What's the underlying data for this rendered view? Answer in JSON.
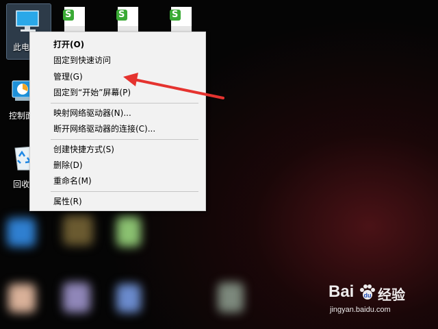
{
  "desktop": {
    "icons": [
      {
        "label": "此电",
        "icon": "computer-icon"
      },
      {
        "label": "控制面",
        "icon": "control-panel-icon"
      },
      {
        "label": "回收",
        "icon": "recycle-bin-icon"
      }
    ],
    "file_icon_badge": "S"
  },
  "context_menu": {
    "items": [
      {
        "label": "打开(O)"
      },
      {
        "label": "固定到快速访问"
      },
      {
        "label": "管理(G)"
      },
      {
        "label": "固定到“开始”屏幕(P)"
      },
      {
        "label": "映射网络驱动器(N)..."
      },
      {
        "label": "断开网络驱动器的连接(C)..."
      },
      {
        "label": "创建快捷方式(S)"
      },
      {
        "label": "删除(D)"
      },
      {
        "label": "重命名(M)"
      },
      {
        "label": "属性(R)"
      }
    ]
  },
  "annotation": {
    "color": "#e5332f"
  },
  "watermark": {
    "brand_left": "Bai",
    "brand_right": "经验",
    "url": "jingyan.baidu.com"
  },
  "colors": {
    "menu_bg": "#f2f2f2",
    "file_badge": "#3aaa35"
  }
}
